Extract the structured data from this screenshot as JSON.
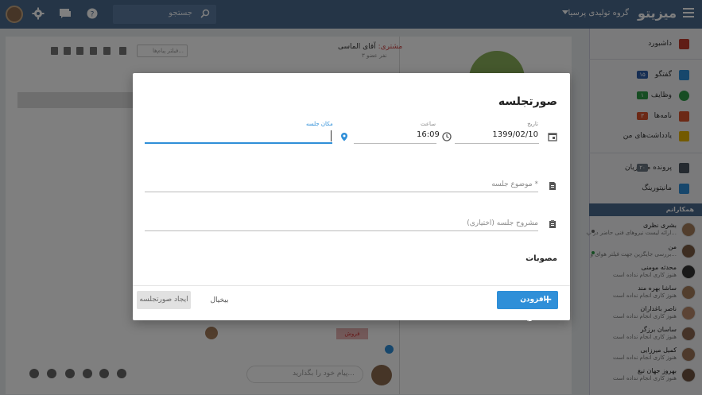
{
  "topbar": {
    "logo": "میزیتو",
    "org": "گروه تولیدی پرسیا",
    "search_placeholder": "جستجو"
  },
  "sidebar": {
    "items": [
      {
        "label": "داشبورد",
        "badge": ""
      },
      {
        "label": "گفتگو",
        "badge": "۱۵"
      },
      {
        "label": "وظایف",
        "badge": "۱"
      },
      {
        "label": "نامه‌ها",
        "badge": "۳"
      },
      {
        "label": "یادداشت‌های من",
        "badge": ""
      },
      {
        "label": "پرونده مشتریان",
        "badge": "۲۰"
      },
      {
        "label": "مانیتورینگ",
        "badge": ""
      }
    ],
    "section_title": "همکارانم",
    "members": [
      {
        "name": "بشری نظری",
        "status": "ارائه لیست نیروهای فنی حاضر در پ..."
      },
      {
        "name": "من",
        "status": "بررسی جایگزین جهت فیلتر هوای و..."
      },
      {
        "name": "محدثه مومنی",
        "status": "هنوز کاری انجام نداده است"
      },
      {
        "name": "ساشا بهره مند",
        "status": "هنوز کاری انجام نداده است"
      },
      {
        "name": "ناصر باغداران",
        "status": "هنوز کاری انجام نداده است"
      },
      {
        "name": "ساسان برزگر",
        "status": "هنوز کاری انجام نداده است"
      },
      {
        "name": "کمیل میرزایی",
        "status": "هنوز کاری انجام نداده است"
      },
      {
        "name": "بهروز جهان تیغ",
        "status": "هنوز کاری انجام نداده است"
      }
    ]
  },
  "chat": {
    "header_role": "مشتری:",
    "header_name": "آقای الماسی",
    "header_sub": "۳ نفر عضو",
    "filter_placeholder": "فیلتر پیام‌ها...",
    "input_placeholder": "پیام خود را بگذارید...",
    "card_tag": "فروش",
    "circle_letter": "آ"
  },
  "modal": {
    "title": "صورتجلسه",
    "date_label": "تاریخ",
    "date_value": "1399/02/10",
    "time_label": "ساعت",
    "time_value": "16:09",
    "location_label": "مکان جلسه",
    "location_value": "",
    "subject_placeholder": "موضوع جلسه *",
    "description_placeholder": "مشروح جلسه (اختیاری)",
    "approvals_label": "مصوبات",
    "add_approval_label": "افزودن مصوبه",
    "cancel_label": "بیخیال",
    "create_label": "ایجاد صورتجلسه"
  },
  "colors": {
    "topbar": "#4a6a8f",
    "accent": "#2f8fd8",
    "badge_blue": "#2f5fa8",
    "badge_green": "#2e9b46",
    "badge_red": "#d9532c"
  }
}
